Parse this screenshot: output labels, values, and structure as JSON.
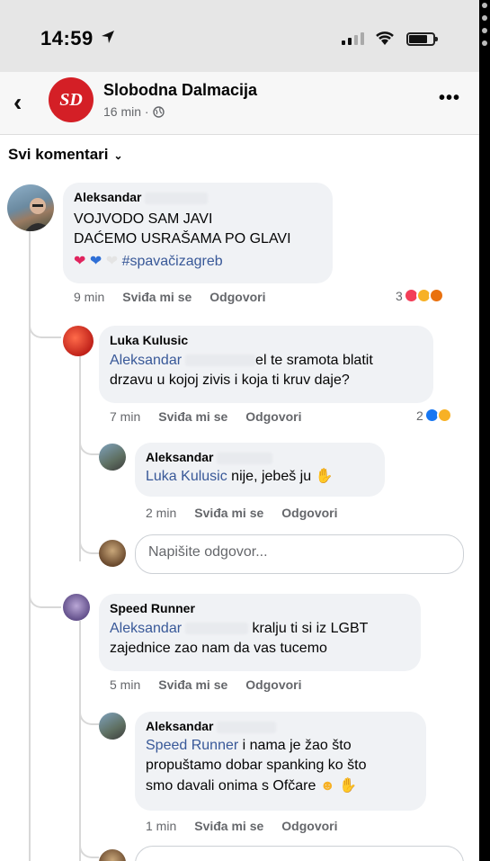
{
  "status_bar": {
    "time": "14:59"
  },
  "header": {
    "page_name": "Slobodna Dalmacija",
    "logo_text": "SD",
    "post_age": "16 min ·"
  },
  "sort_label": "Svi komentari",
  "comments": [
    {
      "name": "Aleksandar",
      "lines": [
        "VOJVODO SAM JAVI",
        "DAĆEMO USRAŠAMA PO GLAVI"
      ],
      "hashtag": "#spavačizagreb",
      "time": "9 min",
      "like": "Sviđa mi se",
      "reply": "Odgovori",
      "reaction_count": "3"
    },
    {
      "name": "Luka Kulusic",
      "mention": "Aleksandar",
      "line1": "el te sramota blatit",
      "line2": "drzavu u kojoj zivis i koja ti kruv daje?",
      "time": "7 min",
      "like": "Sviđa mi se",
      "reply": "Odgovori",
      "reaction_count": "2"
    },
    {
      "name": "Aleksandar",
      "mention": "Luka Kulusic",
      "text": "nije, jebeš ju",
      "time": "2 min",
      "like": "Sviđa mi se",
      "reply": "Odgovori"
    },
    {
      "name": "Speed Runner",
      "mention": "Aleksandar",
      "line1": "kralju ti si iz LGBT",
      "line2": "zajednice zao nam da vas tucemo",
      "time": "5 min",
      "like": "Sviđa mi se",
      "reply": "Odgovori"
    },
    {
      "name": "Aleksandar",
      "mention": "Speed Runner",
      "line1": "i nama je žao što",
      "line2": "propuštamo dobar spanking ko što",
      "line3": "smo davali onima s Ofčare",
      "time": "1 min",
      "like": "Sviđa mi se",
      "reply": "Odgovori"
    }
  ],
  "reply_input": {
    "placeholder": "Napišite odgovor..."
  },
  "colors": {
    "brand_red": "#d41f26",
    "link_blue": "#385898",
    "bubble_bg": "#f0f2f5"
  }
}
